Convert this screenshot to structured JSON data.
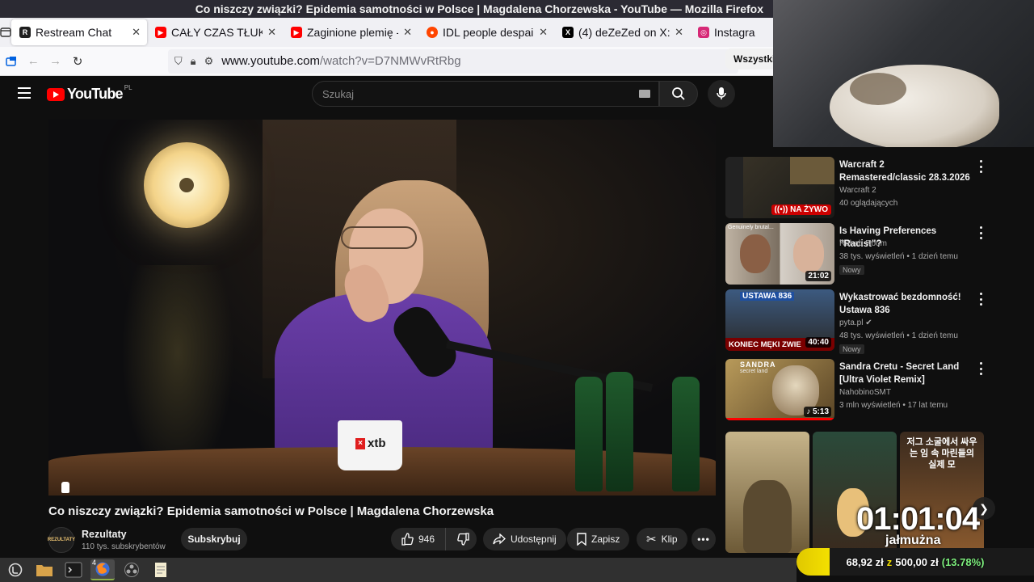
{
  "window": {
    "title": "Co niszczy związki? Epidemia samotności w Polsce | Magdalena Chorzewska - YouTube — Mozilla Firefox"
  },
  "tabs": [
    {
      "title": "Restream Chat",
      "favicon": "restream",
      "color": "#1e1e1e",
      "active": true
    },
    {
      "title": "CAŁY CZAS TŁUKŁO",
      "favicon": "youtube",
      "color": "#ff0000",
      "active": false
    },
    {
      "title": "Zaginione plemię -",
      "favicon": "youtube",
      "color": "#ff0000",
      "active": false
    },
    {
      "title": "IDL people despair",
      "favicon": "reddit",
      "color": "#ff4500",
      "active": false
    },
    {
      "title": "(4) deZeZed on X: \"",
      "favicon": "x",
      "color": "#000000",
      "active": false
    },
    {
      "title": "Instagra",
      "favicon": "instagram",
      "color": "#d62976",
      "active": false
    }
  ],
  "navbar": {
    "url_host": "www.youtube.com",
    "url_path": "/watch?v=D7NMWvRtRbg"
  },
  "youtube": {
    "logo_text": "YouTube",
    "region": "PL",
    "search_placeholder": "Szukaj",
    "video": {
      "title": "Co niszczy związki? Epidemia samotności w Polsce | Magdalena Chorzewska",
      "mug_brand": "xtb",
      "channel": {
        "name": "Rezultaty",
        "subscribers": "110 tys. subskrybentów",
        "avatar_text": "REZULTATY"
      },
      "subscribe_label": "Subskrybuj",
      "likes": "946",
      "share_label": "Udostępnij",
      "save_label": "Zapisz",
      "clip_label": "Klip"
    },
    "chip": "Wszystkie",
    "recommendations": [
      {
        "title": "Warcraft 2 Remastered/classic 28.3.2026",
        "channel": "Warcraft 2",
        "meta": "40 oglądających",
        "live": "NA ŻYWO",
        "badge": "",
        "duration": ""
      },
      {
        "title": "Is Having Preferences \"Racist\"?",
        "channel": "Rehab Room",
        "meta": "38 tys. wyświetleń • 1 dzień temu",
        "live": "",
        "badge": "Nowy",
        "duration": "21:02",
        "thumb_caption": "Genuinely brutal..."
      },
      {
        "title": "Wykastrować bezdomność! Ustawa 836",
        "channel": "pyta.pl",
        "meta": "48 tys. wyświetleń • 1 dzień temu",
        "live": "",
        "badge": "Nowy",
        "duration": "40:40",
        "thumb_top": "USTAWA 836",
        "thumb_bottom": "KONIEC MĘKI ZWIE"
      },
      {
        "title": "Sandra Cretu - Secret Land [Ultra Violet Remix]",
        "channel": "NahobinoSMT",
        "meta": "3 mln wyświetleń • 17 lat temu",
        "live": "",
        "badge": "",
        "duration": "5:13",
        "thumb_top": "SANDRA",
        "thumb_sub": "secret land"
      }
    ],
    "shorts": [
      {
        "text": ""
      },
      {
        "text": ""
      },
      {
        "text": "저그 소굴에서 싸우는 임 속 마린들의 실제 모"
      }
    ]
  },
  "overlay": {
    "timer": "01:01:04",
    "timer_label": "jałmużna",
    "donation": {
      "current": "68,92 zł",
      "sep": "z",
      "goal": "500,00 zł",
      "percent_text": "(13.78%)",
      "fraction": 0.1378
    }
  },
  "taskbar": {
    "terminal_count": "4"
  }
}
